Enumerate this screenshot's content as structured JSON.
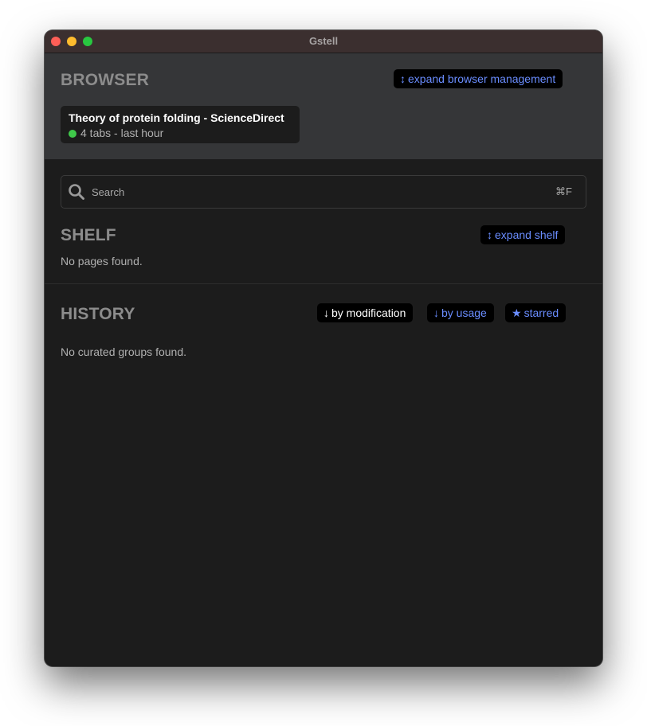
{
  "window": {
    "title": "Gstell"
  },
  "browser": {
    "heading": "BROWSER",
    "expand_glyph": "↕",
    "expand_label": "expand browser management",
    "tab_card": {
      "title": "Theory of protein folding - ScienceDirect",
      "meta": "4 tabs - last hour",
      "status_color": "#3fc84a"
    }
  },
  "search": {
    "placeholder": "Search",
    "value": "",
    "shortcut": "⌘F",
    "icon": "search-icon"
  },
  "shelf": {
    "heading": "SHELF",
    "expand_glyph": "↕",
    "expand_label": "expand shelf",
    "empty_text": "No pages found."
  },
  "history": {
    "heading": "HISTORY",
    "sort_options": [
      {
        "glyph": "↓",
        "label": "by modification",
        "active": true
      },
      {
        "glyph": "↓",
        "label": "by usage",
        "active": false
      },
      {
        "glyph": "★",
        "label": "starred",
        "active": false
      }
    ],
    "empty_text": "No curated groups found."
  },
  "colors": {
    "accent": "#6a8dff",
    "window_bg": "#1c1c1c",
    "browser_bg": "#353638",
    "titlebar_bg": "#3b2f2f"
  }
}
